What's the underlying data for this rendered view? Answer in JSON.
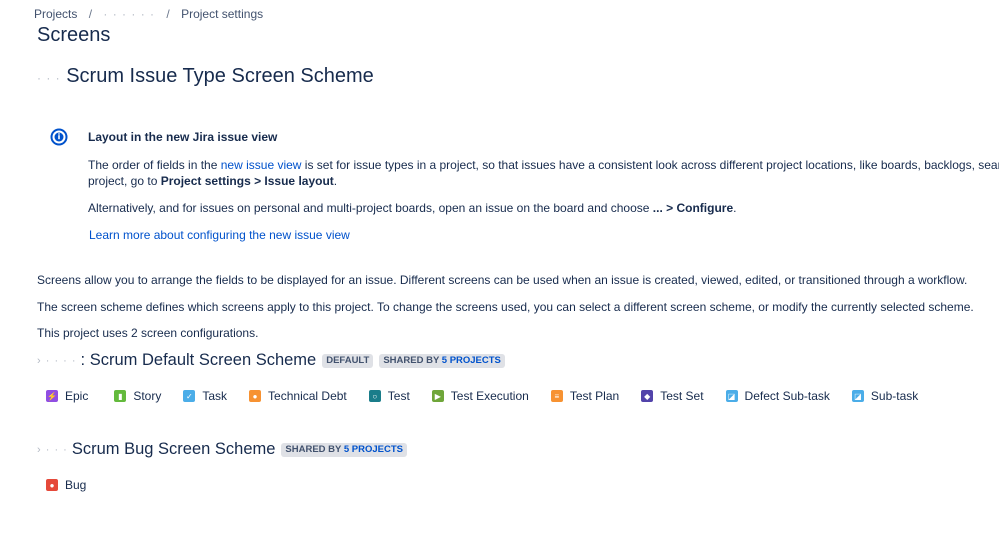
{
  "breadcrumb": {
    "root": "Projects",
    "project": "·  ·  ·  ·  ·  ·",
    "current": "Project settings"
  },
  "page": {
    "title": "Screens",
    "scheme_prefix": "·  ·  ·",
    "scheme_title": "Scrum Issue Type Screen Scheme"
  },
  "info": {
    "heading": "Layout in the new Jira issue view",
    "p1_before": "The order of fields in the ",
    "p1_link": "new issue view",
    "p1_after": " is set for issue types in a project, so that issues have a consistent look across different project locations, like boards, backlogs, search, and",
    "p1b_before": "project, go to ",
    "p1b_bold": "Project settings > Issue layout",
    "p1b_after": ".",
    "p2_before": "Alternatively, and for issues on personal and multi-project boards, open an issue on the board and choose ",
    "p2_bold1": "... > Configure",
    "p2_after": ".",
    "link": "Learn more about configuring the new issue view"
  },
  "description": {
    "line1": "Screens allow you to arrange the fields to be displayed for an issue. Different screens can be used when an issue is created, viewed, edited, or transitioned through a workflow.",
    "line2": "The screen scheme defines which screens apply to this project. To change the screens used, you can select a different screen scheme, or modify the currently selected scheme.",
    "line3": "This project uses 2 screen configurations."
  },
  "screens": [
    {
      "prefix": "›  ·  ·  ·  ·",
      "name": ": Scrum Default Screen Scheme",
      "badge_default": "DEFAULT",
      "badge_shared_pre": "SHARED BY ",
      "badge_shared_num": "5 PROJECTS",
      "issue_types": [
        {
          "label": "Epic",
          "icon": "epic-icon",
          "color": "#904ee2",
          "glyph": "⚡"
        },
        {
          "label": "Story",
          "icon": "story-icon",
          "color": "#63ba3c",
          "glyph": "▮"
        },
        {
          "label": "Task",
          "icon": "task-icon",
          "color": "#4bade8",
          "glyph": "✓"
        },
        {
          "label": "Technical Debt",
          "icon": "technical-debt-icon",
          "color": "#f79232",
          "glyph": "●"
        },
        {
          "label": "Test",
          "icon": "test-icon",
          "color": "#1a7d8a",
          "glyph": "○"
        },
        {
          "label": "Test Execution",
          "icon": "test-execution-icon",
          "color": "#6fa63a",
          "glyph": "▶"
        },
        {
          "label": "Test Plan",
          "icon": "test-plan-icon",
          "color": "#f79232",
          "glyph": "≡"
        },
        {
          "label": "Test Set",
          "icon": "test-set-icon",
          "color": "#5243aa",
          "glyph": "◆"
        },
        {
          "label": "Defect Sub-task",
          "icon": "defect-subtask-icon",
          "color": "#4bade8",
          "glyph": "◪"
        },
        {
          "label": "Sub-task",
          "icon": "subtask-icon",
          "color": "#4bade8",
          "glyph": "◪"
        }
      ]
    },
    {
      "prefix": "›  ·  ·  ·",
      "name": "Scrum Bug Screen Scheme",
      "badge_shared_pre": "SHARED BY ",
      "badge_shared_num": "5 PROJECTS",
      "issue_types": [
        {
          "label": "Bug",
          "icon": "bug-icon",
          "color": "#e5493a",
          "glyph": "●"
        }
      ]
    }
  ]
}
